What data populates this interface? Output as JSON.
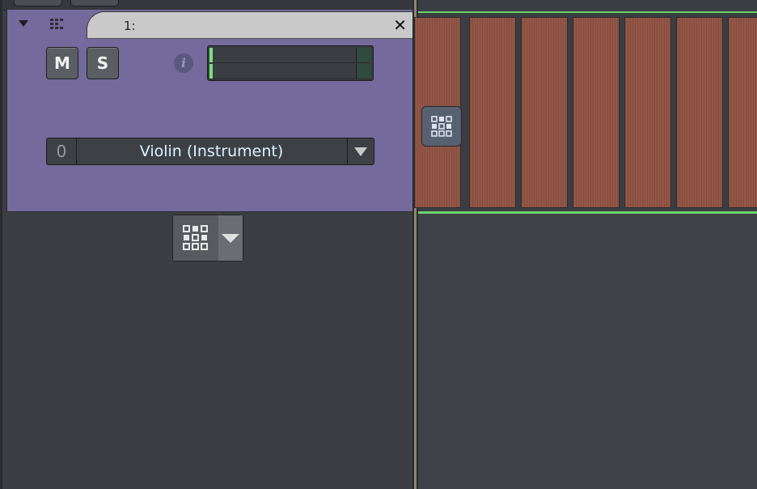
{
  "track": {
    "name": "1:",
    "close_label": "✕",
    "mute_label": "M",
    "solo_label": "S",
    "info_label": "i",
    "instrument_number": "0",
    "instrument_name": "Violin (Instrument)",
    "color": "#746a9b",
    "meter_levels": [
      0.02,
      0.02
    ]
  },
  "icons": {
    "collapse": "triangle-down-icon",
    "midi": "midi-pattern-icon",
    "grid": "grid-icon",
    "dropdown": "chevron-down-icon"
  },
  "timeline": {
    "pattern_count": 7,
    "pattern_color": "#935646",
    "selection_color": "#6ed06e"
  }
}
